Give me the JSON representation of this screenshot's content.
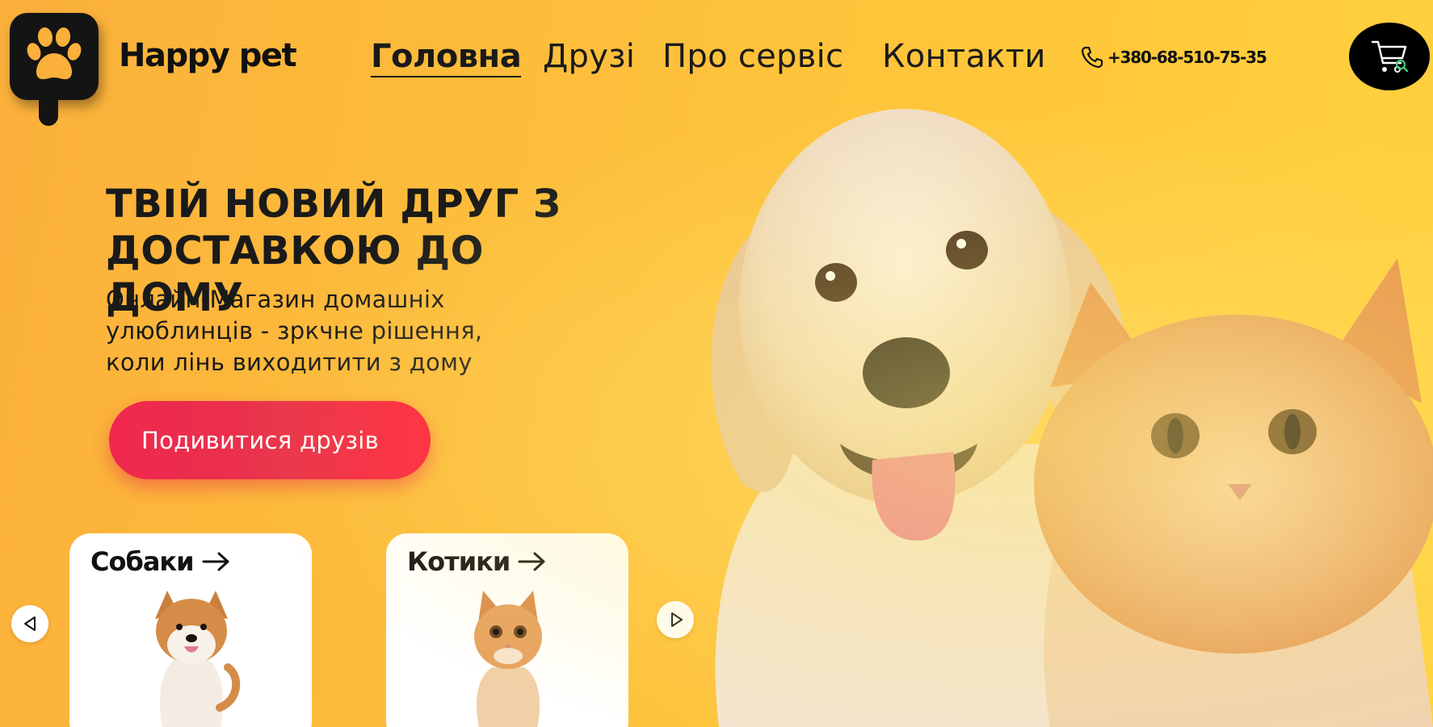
{
  "brand": {
    "name": "Happy pet",
    "logo_icon": "paw-icon"
  },
  "nav": {
    "items": [
      {
        "label": "Головна",
        "active": true
      },
      {
        "label": "Друзі",
        "active": false
      },
      {
        "label": "Про сервіс",
        "active": false
      },
      {
        "label": "Контакти",
        "active": false
      }
    ],
    "phone": "+380-68-510-75-35",
    "phone_icon": "phone-icon",
    "cart_icon": "cart-search-icon"
  },
  "hero": {
    "headline_line1": "ТВІЙ НОВИЙ ДРУГ З",
    "headline_line2": "ДОСТАВКОЮ ДО ДОМУ",
    "subtitle_line1": "Онлайн-Магазин домашніх",
    "subtitle_line2": "улюблинців - зркчне рішення,",
    "subtitle_line3": "коли лінь виходитити з дому",
    "cta_label": "Подивитися друзів"
  },
  "categories": [
    {
      "label": "Собаки",
      "icon": "arrow-right-icon"
    },
    {
      "label": "Котики",
      "icon": "arrow-right-icon"
    }
  ],
  "slider": {
    "prev_icon": "triangle-left-icon",
    "next_icon": "triangle-right-icon"
  },
  "colors": {
    "background_start": "#fbb03b",
    "background_end": "#ffd23e",
    "cta": "#f0284f",
    "dark": "#141414"
  }
}
